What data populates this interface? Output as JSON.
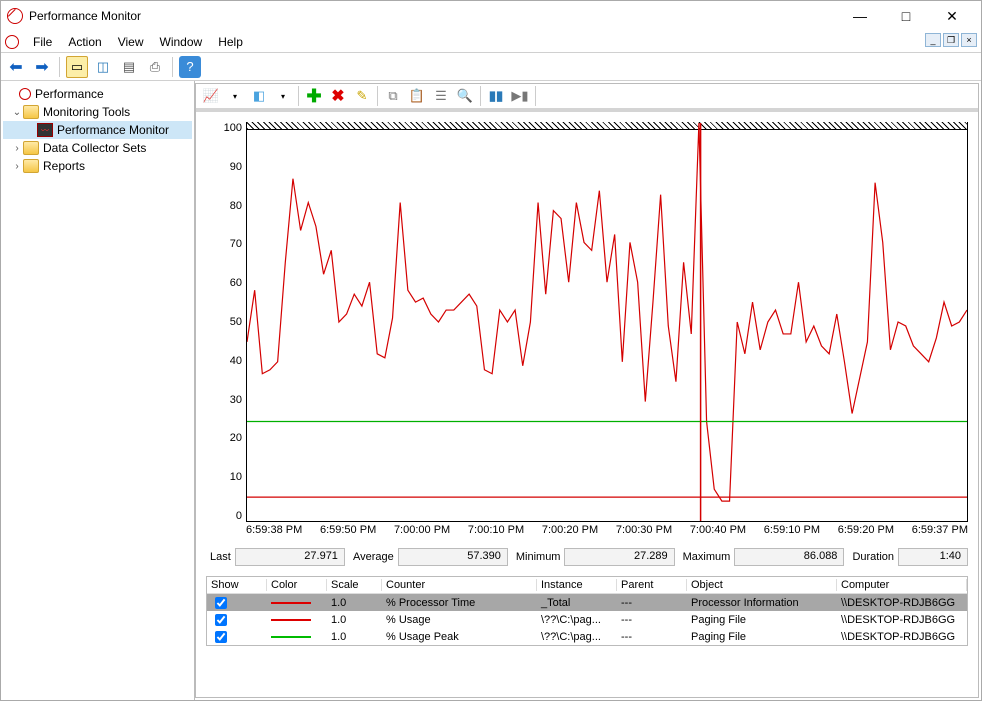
{
  "window": {
    "title": "Performance Monitor",
    "menu": [
      "File",
      "Action",
      "View",
      "Window",
      "Help"
    ]
  },
  "tree": {
    "root": "Performance",
    "nodes": [
      {
        "label": "Monitoring Tools",
        "children": [
          {
            "label": "Performance Monitor",
            "selected": true
          }
        ]
      },
      {
        "label": "Data Collector Sets"
      },
      {
        "label": "Reports"
      }
    ]
  },
  "chart_data": {
    "type": "line",
    "ylim": [
      0,
      100
    ],
    "yticks": [
      100,
      90,
      80,
      70,
      60,
      50,
      40,
      30,
      20,
      10,
      0
    ],
    "xticks": [
      "6:59:38 PM",
      "6:59:50 PM",
      "7:00:00 PM",
      "7:00:10 PM",
      "7:00:20 PM",
      "7:00:30 PM",
      "7:00:40 PM",
      "6:59:10 PM",
      "6:59:20 PM",
      "6:59:37 PM"
    ],
    "cursor_x": 63,
    "series": [
      {
        "name": "% Processor Time",
        "color": "#d40000",
        "values": [
          45,
          58,
          37,
          38,
          40,
          65,
          86,
          73,
          80,
          74,
          62,
          68,
          50,
          52,
          57,
          54,
          60,
          42,
          41,
          51,
          80,
          58,
          55,
          56,
          52,
          50,
          53,
          53,
          55,
          57,
          54,
          38,
          37,
          53,
          50,
          53,
          39,
          50,
          80,
          57,
          78,
          76,
          60,
          80,
          70,
          68,
          83,
          60,
          72,
          40,
          70,
          60,
          30,
          55,
          82,
          49,
          35,
          65,
          47,
          100,
          25,
          8,
          5,
          5,
          50,
          42,
          55,
          43,
          50,
          53,
          47,
          47,
          60,
          45,
          49,
          44,
          42,
          52,
          40,
          27,
          36,
          45,
          85,
          70,
          43,
          50,
          49,
          44,
          42,
          40,
          46,
          55,
          49,
          50,
          53
        ]
      },
      {
        "name": "% Usage",
        "color": "#d40000",
        "values_flat": 6
      },
      {
        "name": "% Usage Peak",
        "color": "#00b000",
        "values_flat": 25
      }
    ]
  },
  "stats": {
    "last_label": "Last",
    "last": "27.971",
    "avg_label": "Average",
    "avg": "57.390",
    "min_label": "Minimum",
    "min": "27.289",
    "max_label": "Maximum",
    "max": "86.088",
    "dur_label": "Duration",
    "dur": "1:40"
  },
  "table": {
    "headers": [
      "Show",
      "Color",
      "Scale",
      "Counter",
      "Instance",
      "Parent",
      "Object",
      "Computer"
    ],
    "rows": [
      {
        "checked": true,
        "color": "red",
        "scale": "1.0",
        "counter": "% Processor Time",
        "instance": "_Total",
        "parent": "---",
        "object": "Processor Information",
        "computer": "\\\\DESKTOP-RDJB6GG",
        "selected": true
      },
      {
        "checked": true,
        "color": "red",
        "scale": "1.0",
        "counter": "% Usage",
        "instance": "\\??\\C:\\pag...",
        "parent": "---",
        "object": "Paging File",
        "computer": "\\\\DESKTOP-RDJB6GG"
      },
      {
        "checked": true,
        "color": "green",
        "scale": "1.0",
        "counter": "% Usage Peak",
        "instance": "\\??\\C:\\pag...",
        "parent": "---",
        "object": "Paging File",
        "computer": "\\\\DESKTOP-RDJB6GG"
      }
    ]
  }
}
